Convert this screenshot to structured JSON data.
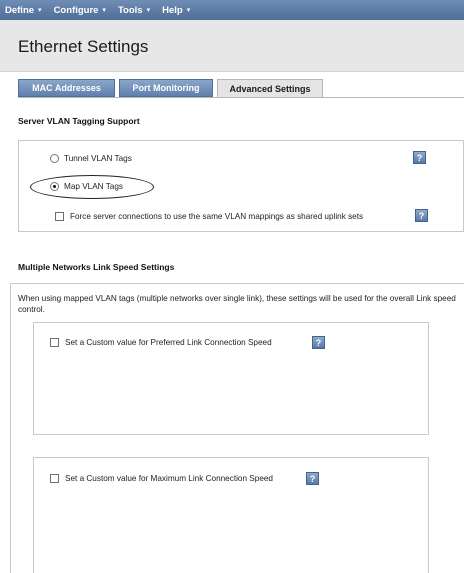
{
  "menu": {
    "items": [
      {
        "label": "Define"
      },
      {
        "label": "Configure"
      },
      {
        "label": "Tools"
      },
      {
        "label": "Help"
      }
    ],
    "caret": "▾"
  },
  "header": {
    "title": "Ethernet Settings"
  },
  "tabs": [
    {
      "label": "MAC Addresses",
      "active": false
    },
    {
      "label": "Port Monitoring",
      "active": false
    },
    {
      "label": "Advanced Settings",
      "active": true
    }
  ],
  "vlan_section": {
    "title": "Server VLAN Tagging Support",
    "options": [
      {
        "label": "Tunnel VLAN Tags",
        "selected": false
      },
      {
        "label": "Map VLAN Tags",
        "selected": true
      }
    ],
    "force_checkbox": {
      "label": "Force server connections to use the same VLAN mappings as shared uplink sets",
      "checked": false
    }
  },
  "speed_section": {
    "title": "Multiple Networks Link Speed Settings",
    "description": "When using mapped VLAN tags (multiple networks over single link), these settings will be used for the overall Link speed control.",
    "preferred_checkbox": {
      "label": "Set a Custom value for Preferred Link Connection Speed",
      "checked": false
    },
    "maximum_checkbox": {
      "label": "Set a Custom value for Maximum Link Connection Speed",
      "checked": false
    }
  },
  "help_icon_glyph": "?",
  "colors": {
    "menubar": "#4e6d97",
    "tab_inactive": "#5f80ad",
    "help_icon": "#5a7aa6",
    "header_bg": "#e7e7e7"
  }
}
